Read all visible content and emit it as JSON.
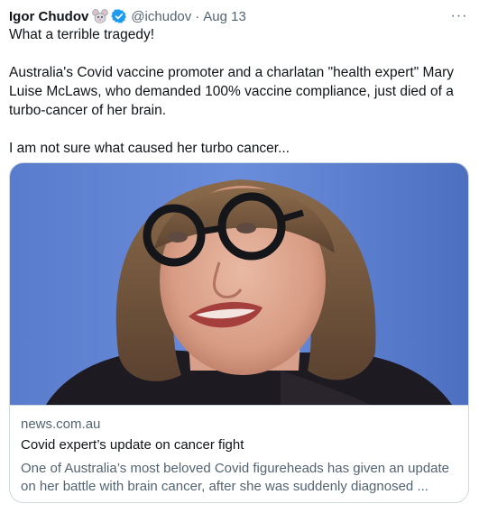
{
  "tweet": {
    "author_name": "Igor Chudov",
    "author_emoji": "mouse-face-emoji",
    "verified_icon": "verified-badge-icon",
    "handle": "@ichudov",
    "separator": "·",
    "date": "Aug 13",
    "more_icon": "more-horizontal-icon",
    "more_label": "···",
    "text": {
      "line1": "What a terrible tragedy!",
      "paragraph2": "Australia's Covid vaccine promoter and a charlatan \"health expert\" Mary Luise McLaws, who demanded 100% vaccine compliance, just died of a turbo-cancer of her brain.",
      "line3": "I am not sure what caused her turbo cancer..."
    }
  },
  "card": {
    "image_subject": "portrait of woman with bob haircut and round dark glasses against blue background",
    "domain": "news.com.au",
    "title": "Covid expert’s update on cancer fight",
    "description": "One of Australia’s most beloved Covid figureheads has given an update on her battle with brain cancer, after she was suddenly diagnosed ..."
  },
  "colors": {
    "text_primary": "#0f1419",
    "text_secondary": "#536471",
    "border": "#cfd9de",
    "verified_blue": "#1d9bf0",
    "photo_background": "#5f7fd0"
  }
}
